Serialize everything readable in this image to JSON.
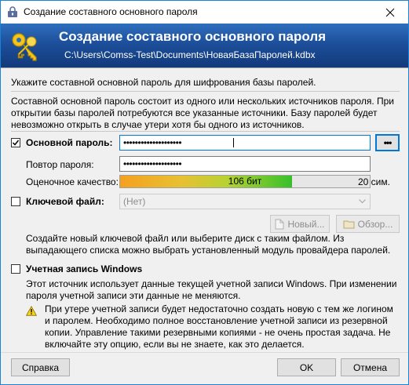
{
  "window": {
    "title": "Создание составного основного пароля"
  },
  "banner": {
    "title": "Создание составного основного пароля",
    "path": "C:\\Users\\Comss-Test\\Documents\\НоваяБазаПаролей.kdbx"
  },
  "intro": {
    "line1": "Укажите составной основной пароль для шифрования базы паролей.",
    "para": "Составной основной пароль состоит из одного или нескольких источников пароля. При открытии базы паролей потребуются все указанные источники. Базу паролей будет невозможно открыть в случае утери хотя бы одного из источников."
  },
  "master_password": {
    "label": "Основной пароль:",
    "checked": true,
    "value": "••••••••••••••••••••",
    "toggle_label": "•••",
    "repeat_label": "Повтор пароля:",
    "repeat_value": "••••••••••••••••••••",
    "quality_label": "Оценочное качество:",
    "quality_text": "106 бит",
    "quality_fraction": 0.69,
    "char_count": "20 сим."
  },
  "key_file": {
    "label": "Ключевой файл:",
    "checked": false,
    "selected": "(Нет)",
    "new_label": "Новый...",
    "browse_label": "Обзор...",
    "hint": "Создайте новый ключевой файл или выберите диск с таким файлом. Из выпадающего списка можно выбрать установленный модуль провайдера паролей."
  },
  "windows_account": {
    "label": "Учетная запись Windows",
    "checked": false,
    "desc": "Этот источник использует данные текущей учетной записи Windows. При изменении пароля учетной записи эти данные не меняются.",
    "warning": "При утере учетной записи будет недостаточно создать новую с тем же логином и паролем. Необходимо полное восстановление учетной записи из резервной копии. Управление такими резервными копиями - не очень простая задача. Не включайте эту опцию, если вы не знаете, как это делается."
  },
  "buttons": {
    "help": "Справка",
    "ok": "OK",
    "cancel": "Отмена"
  }
}
